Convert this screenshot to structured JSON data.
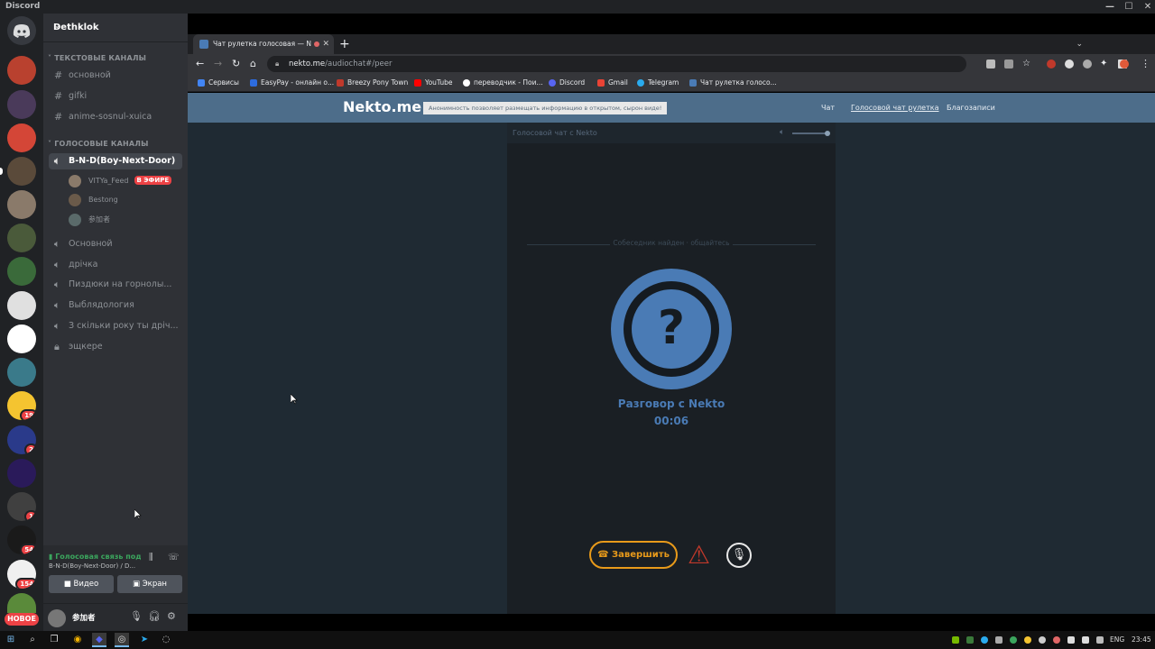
{
  "window": {
    "title": "Discord",
    "minimize": "—",
    "maximize": "☐",
    "close": "✕"
  },
  "discord": {
    "guild_name": "Dethklok",
    "categories": {
      "text": "ТЕКСТОВЫЕ КАНАЛЫ",
      "voice": "ГОЛОСОВЫЕ КАНАЛЫ"
    },
    "text_channels": [
      "основной",
      "gifki",
      "anime-sosnul-xuica"
    ],
    "voice_channels": [
      "B-N-D(Boy-Next-Door)",
      "Основной",
      "дрічка",
      "Пиздюки на горнолы...",
      "Выблядология",
      "З скільки року ты дріч...",
      "эщкере"
    ],
    "voice_users": [
      {
        "name": "VITYa_Feed",
        "live": "В ЭФИРЕ"
      },
      {
        "name": "Bestong",
        "live": ""
      },
      {
        "name": "参加者",
        "live": ""
      }
    ],
    "server_badges": [
      "19",
      "2",
      "1",
      "54",
      "154"
    ],
    "new_badge": "НОВОЕ",
    "voice_status": "Голосовая связь подк",
    "voice_location": "B-N-D(Boy-Next-Door) / D...",
    "video_label": "Видео",
    "screen_label": "Экран",
    "username": "参加者",
    "accent": "#5865f2",
    "status_green": "#3ba55d"
  },
  "browser": {
    "tab_title": "Чат рулетка голосовая — N",
    "url_host": "nekto.me",
    "url_path": "/audiochat#/peer",
    "bookmarks": [
      {
        "label": "Сервисы",
        "color": "#4285f4"
      },
      {
        "label": "EasyPay - онлайн о...",
        "color": "#2d6cdf"
      },
      {
        "label": "Breezy Pony Town",
        "color": "#c0392b"
      },
      {
        "label": "YouTube",
        "color": "#ff0000"
      },
      {
        "label": "переводчик - Пои...",
        "color": "#ffffff"
      },
      {
        "label": "Discord",
        "color": "#5865f2"
      },
      {
        "label": "Gmail",
        "color": "#ea4335"
      },
      {
        "label": "Telegram",
        "color": "#2aabee"
      },
      {
        "label": "Чат рулетка голосо...",
        "color": "#4a7bb5"
      }
    ]
  },
  "nekto": {
    "logo": "Nekto.me",
    "notice": "Анонимность позволяет размещать информацию в открытом, сырон виде!",
    "nav": [
      "Чат",
      "Голосовой чат рулетка",
      "Благозаписи"
    ],
    "panel_title": "Голосовой чат с Nekto",
    "found_text": "Собеседник найден · общайтесь",
    "avatar_glyph": "?",
    "talk_label": "Разговор с Nekto",
    "timer": "00:06",
    "end_button": "Завершить",
    "brand_blue": "#4a7bb5",
    "end_orange": "#e89a1a"
  },
  "taskbar": {
    "lang": "ENG",
    "time": "23:45"
  }
}
